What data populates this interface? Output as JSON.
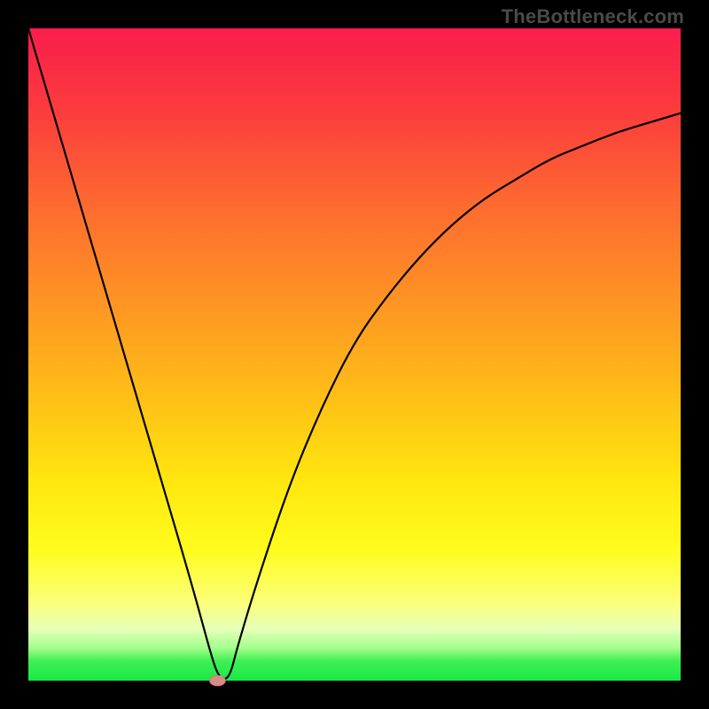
{
  "watermark": "TheBottleneck.com",
  "chart_data": {
    "type": "line",
    "title": "",
    "xlabel": "",
    "ylabel": "",
    "xlim": [
      0,
      100
    ],
    "ylim": [
      0,
      100
    ],
    "legend": false,
    "grid": false,
    "series": [
      {
        "name": "curve",
        "x": [
          0,
          5,
          10,
          15,
          20,
          25,
          28,
          29,
          30,
          31,
          32,
          35,
          40,
          45,
          50,
          55,
          60,
          65,
          70,
          75,
          80,
          85,
          90,
          95,
          100
        ],
        "values": [
          100,
          83,
          66,
          49,
          32,
          15,
          4,
          1,
          0,
          1,
          5,
          15,
          30,
          42,
          52,
          59,
          65,
          70,
          74,
          77,
          80,
          82,
          84,
          85.5,
          87
        ]
      }
    ],
    "annotations": [
      {
        "kind": "marker",
        "x": 29,
        "y": 0,
        "shape": "ellipse",
        "color": "#d88a84"
      }
    ],
    "background_gradient": {
      "direction": "vertical",
      "stops": [
        {
          "pos": 0.0,
          "color": "#fa1d4d"
        },
        {
          "pos": 0.28,
          "color": "#fd6d2f"
        },
        {
          "pos": 0.58,
          "color": "#ffc316"
        },
        {
          "pos": 0.8,
          "color": "#fffc1e"
        },
        {
          "pos": 0.95,
          "color": "#a3ff8c"
        },
        {
          "pos": 1.0,
          "color": "#19e84a"
        }
      ]
    }
  }
}
